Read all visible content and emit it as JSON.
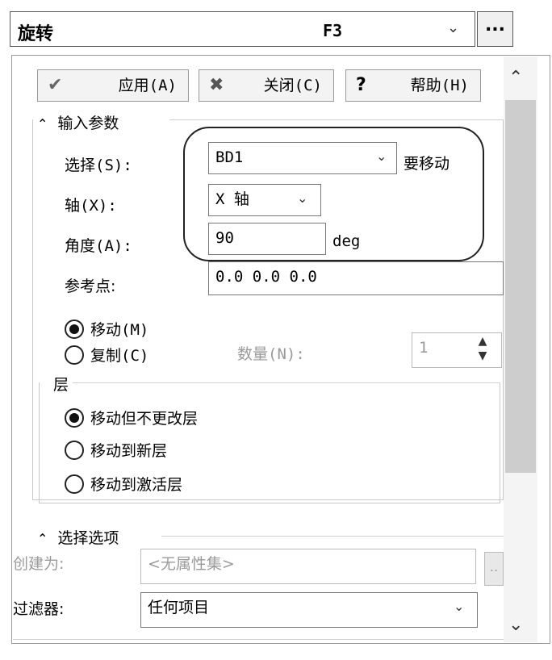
{
  "command": {
    "name": "旋转",
    "hotkey": "F3",
    "dropdown_icon": "chevron-down",
    "more_label": "..."
  },
  "toolbar": {
    "apply_label": "应用(A)",
    "close_label": "关闭(C)",
    "help_label": "帮助(H)",
    "help_glyph": "?"
  },
  "input_params": {
    "header": "输入参数",
    "select_label": "选择(S):",
    "select_value": "BD1",
    "select_annotation": "要移动",
    "axis_label": "轴(X):",
    "axis_value": "X 轴",
    "angle_label": "角度(A):",
    "angle_value": "90",
    "angle_unit": "deg",
    "ref_label": "参考点:",
    "ref_value": "0.0 0.0 0.0",
    "mode_move": "移动(M)",
    "mode_copy": "复制(C)",
    "mode_selected": "move",
    "count_label": "数量(N):",
    "count_value": "1"
  },
  "layer": {
    "header": "层",
    "options": [
      "移动但不更改层",
      "移动到新层",
      "移动到激活层"
    ],
    "selected_index": 0
  },
  "select_options": {
    "header": "选择选项",
    "create_as_label": "创建为:",
    "create_as_value": "<无属性集>",
    "create_as_button": "..",
    "filter_label": "过滤器:",
    "filter_value": "任何项目"
  },
  "scroll": {
    "up_glyph": "^",
    "down_glyph": "v"
  }
}
